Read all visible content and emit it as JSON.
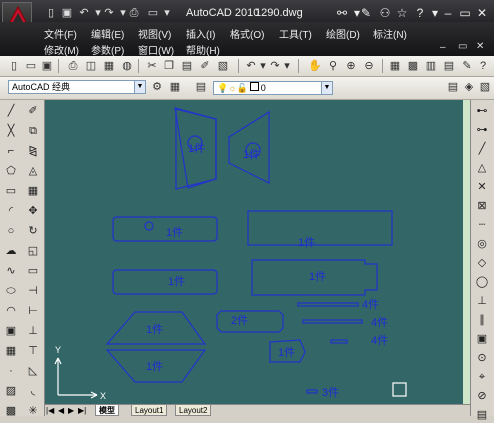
{
  "window": {
    "app_title": "AutoCAD 2010",
    "file_name": "1290.dwg",
    "title_right_icons": [
      "binoculars-icon",
      "tools-icon",
      "users-icon",
      "star-icon",
      "help-icon"
    ]
  },
  "menubar": {
    "row1": [
      "文件(F)",
      "编辑(E)",
      "视图(V)",
      "插入(I)",
      "格式(O)",
      "工具(T)",
      "绘图(D)",
      "标注(N)"
    ],
    "row2": [
      "修改(M)",
      "参数(P)",
      "窗口(W)",
      "帮助(H)"
    ]
  },
  "workspace": {
    "name": "AutoCAD 经典",
    "layer_value": "0"
  },
  "layout_tabs": [
    "模型",
    "Layout1",
    "Layout2"
  ],
  "drawing": {
    "labels": [
      "1件",
      "1件",
      "1件",
      "1件",
      "1件",
      "1件",
      "2件",
      "1件",
      "1件",
      "1件",
      "4件",
      "4件",
      "4件",
      "3件"
    ],
    "axis_x": "X",
    "axis_y": "Y"
  },
  "colors": {
    "canvas_bg": "#336666",
    "line": "#2233cc",
    "label": "#1f2ad6"
  }
}
